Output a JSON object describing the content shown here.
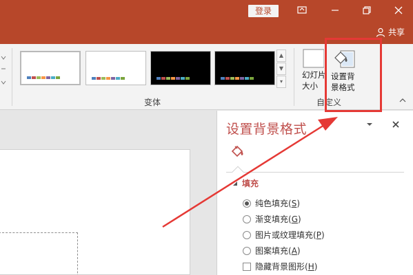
{
  "titlebar": {
    "login_label": "登录",
    "share_label": "共享",
    "icons": [
      "ribbon-display-options-icon",
      "minimize-icon",
      "restore-icon",
      "close-icon",
      "person-icon"
    ]
  },
  "ribbon": {
    "variants_group_label": "变体",
    "customize_group_label": "自定义",
    "slide_size_label_line1": "幻灯片",
    "slide_size_label_line2": "大小",
    "format_bg_label_line1": "设置背",
    "format_bg_label_line2": "景格式",
    "variant_swatch_colors": [
      "#4f81bd",
      "#c0504d",
      "#9bbb59",
      "#f79646",
      "#8064a2",
      "#4bacc6",
      "#7aa53d"
    ]
  },
  "pane": {
    "title": "设置背景格式",
    "fill_section": "填充",
    "options": [
      {
        "label": "纯色填充(",
        "key": "S",
        "end": ")",
        "selected": true
      },
      {
        "label": "渐变填充(",
        "key": "G",
        "end": ")",
        "selected": false
      },
      {
        "label": "图片或纹理填充(",
        "key": "P",
        "end": ")",
        "selected": false
      },
      {
        "label": "图案填充(",
        "key": "A",
        "end": ")",
        "selected": false
      }
    ],
    "hide_bg_label": "隐藏背景图形(",
    "hide_bg_key": "H",
    "hide_bg_end": ")"
  },
  "colors": {
    "accent": "#b7472a",
    "pane_title": "#c0504d",
    "annotation": "#e53935"
  }
}
